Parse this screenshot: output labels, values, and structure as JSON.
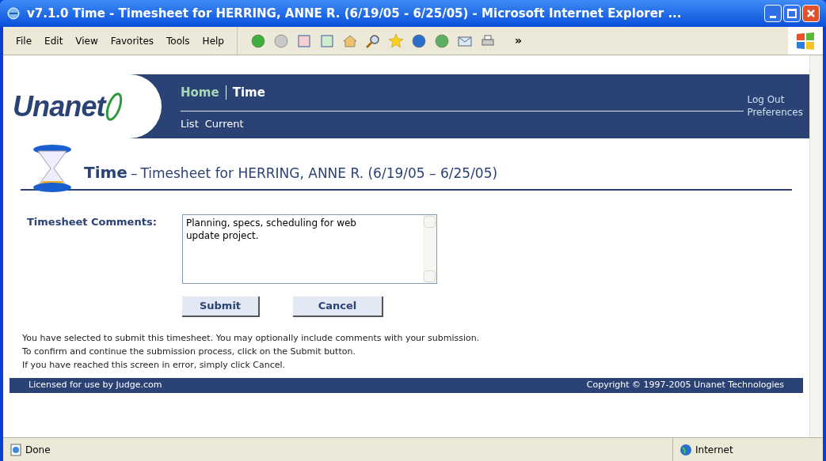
{
  "window": {
    "title": "v7.1.0 Time - Timesheet for HERRING, ANNE R. (6/19/05 - 6/25/05) - Microsoft Internet Explorer ..."
  },
  "menu": [
    "File",
    "Edit",
    "View",
    "Favorites",
    "Tools",
    "Help"
  ],
  "toolbar_overflow": "»",
  "header": {
    "logo": "Unanet",
    "nav": [
      {
        "label": "Home",
        "selected": false
      },
      {
        "label": "Time",
        "selected": true
      }
    ],
    "subnav": [
      "List",
      "Current"
    ],
    "links": [
      "Log Out",
      "Preferences"
    ]
  },
  "page_title": {
    "main": "Time",
    "dash": "–",
    "rest": "Timesheet for HERRING, ANNE R. (6/19/05 – 6/25/05)"
  },
  "form": {
    "label": "Timesheet Comments:",
    "value": "Planning, specs, scheduling for web update project.",
    "buttons": [
      "Submit",
      "Cancel"
    ]
  },
  "messages": [
    "You have selected to submit this timesheet. You may optionally include comments with your submission.",
    "To confirm and continue the submission process, click on the Submit button.",
    "If you have reached this screen in error, simply click Cancel."
  ],
  "footer": {
    "left": "Licensed for use by Judge.com",
    "right": "Copyright © 1997-2005 Unanet Technologies"
  },
  "status_bar": {
    "text": "Done",
    "zone": "Internet"
  }
}
